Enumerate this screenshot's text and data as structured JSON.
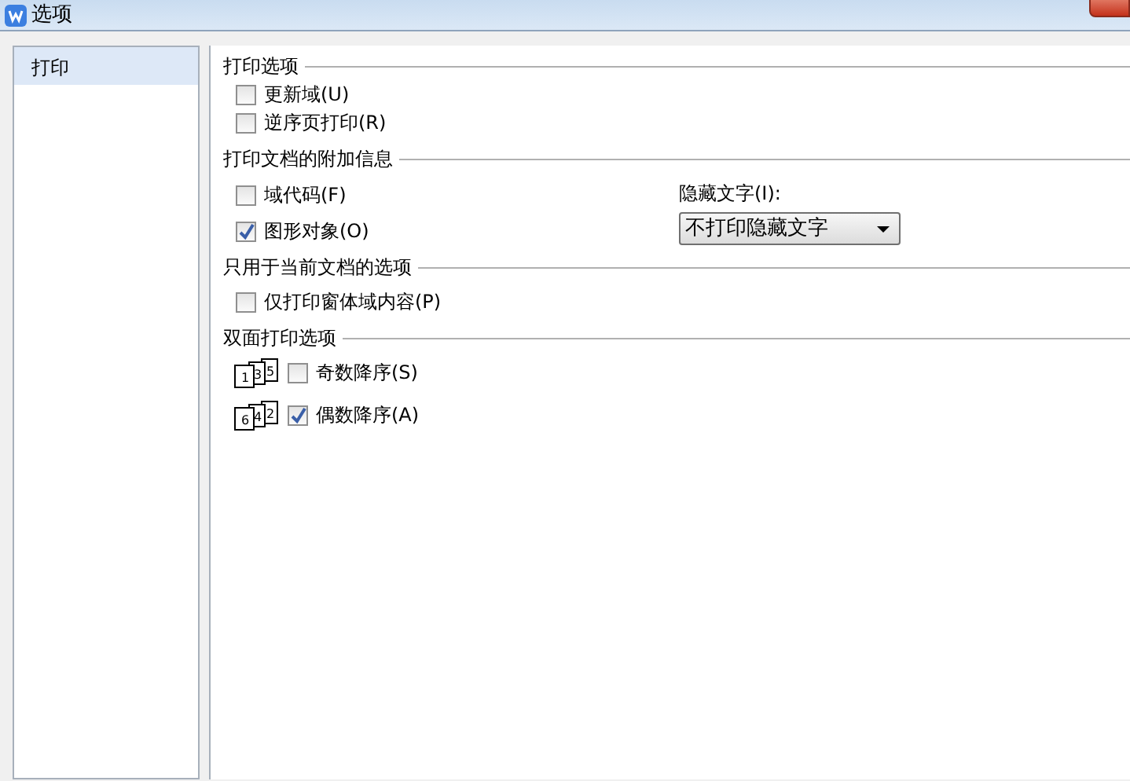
{
  "window": {
    "title": "选项"
  },
  "sidebar": {
    "items": [
      {
        "label": "打印",
        "selected": true
      }
    ]
  },
  "sections": [
    {
      "title": "打印选项",
      "options": [
        {
          "label": "更新域(U)",
          "checked": false
        },
        {
          "label": "逆序页打印(R)",
          "checked": false
        }
      ]
    },
    {
      "title": "打印文档的附加信息",
      "options": [
        {
          "label": "域代码(F)",
          "checked": false
        },
        {
          "label": "图形对象(O)",
          "checked": true
        }
      ],
      "side": {
        "label": "隐藏文字(I):",
        "select_value": "不打印隐藏文字"
      }
    },
    {
      "title": "只用于当前文档的选项",
      "options": [
        {
          "label": "仅打印窗体域内容(P)",
          "checked": false
        }
      ]
    },
    {
      "title": "双面打印选项",
      "options": [
        {
          "label": "奇数降序(S)",
          "checked": false,
          "page_numbers": [
            "1",
            "3",
            "5"
          ]
        },
        {
          "label": "偶数降序(A)",
          "checked": true,
          "page_numbers": [
            "6",
            "4",
            "2"
          ]
        }
      ]
    }
  ]
}
